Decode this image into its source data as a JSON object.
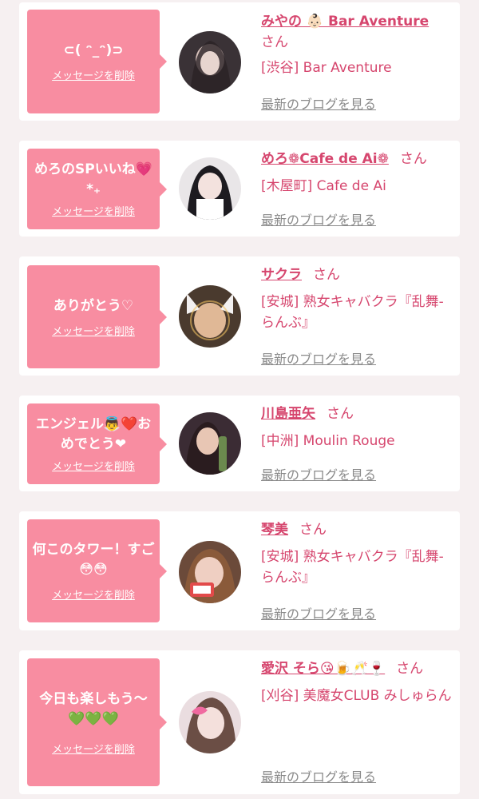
{
  "colors": {
    "bubble": "#f88da1",
    "name": "#d6466e",
    "blog_link": "#8a8a8a",
    "page_background": "#f6f0f1"
  },
  "delete_label": "メッセージを削除",
  "blog_label": "最新のブログを見る",
  "san": "さん",
  "cards": [
    {
      "message": "⊂( ᵔ_ᵔ)⊃",
      "name": "みやの 👶🏻 Bar Aventure",
      "shop": "[渋谷] Bar Aventure",
      "avatar_icon": "avatar-photo"
    },
    {
      "message": "めろのSPいいね💗*₊",
      "name": "めろ❁Cafe de Ai❁",
      "shop": "[木屋町] Cafe de Ai",
      "avatar_icon": "avatar-photo"
    },
    {
      "message": "ありがとう♡",
      "name": "サクラ",
      "shop": "[安城] 熟女キャバクラ『乱舞-らんぶ』",
      "avatar_icon": "avatar-photo"
    },
    {
      "message": "エンジェル👼❤️おめでとう❤",
      "name": "川島亜矢",
      "shop": "[中洲] Moulin Rouge",
      "avatar_icon": "avatar-photo"
    },
    {
      "message": "何このタワー！すご😳😳",
      "name": "琴美",
      "shop": "[安城] 熟女キャバクラ『乱舞-らんぶ』",
      "avatar_icon": "avatar-photo"
    },
    {
      "message": "今日も楽しもう〜💚💚💚",
      "name": "愛沢 そら😘🍺🥂🍷",
      "shop": "[刈谷] 美魔女CLUB みしゅらん",
      "avatar_icon": "avatar-photo"
    }
  ]
}
